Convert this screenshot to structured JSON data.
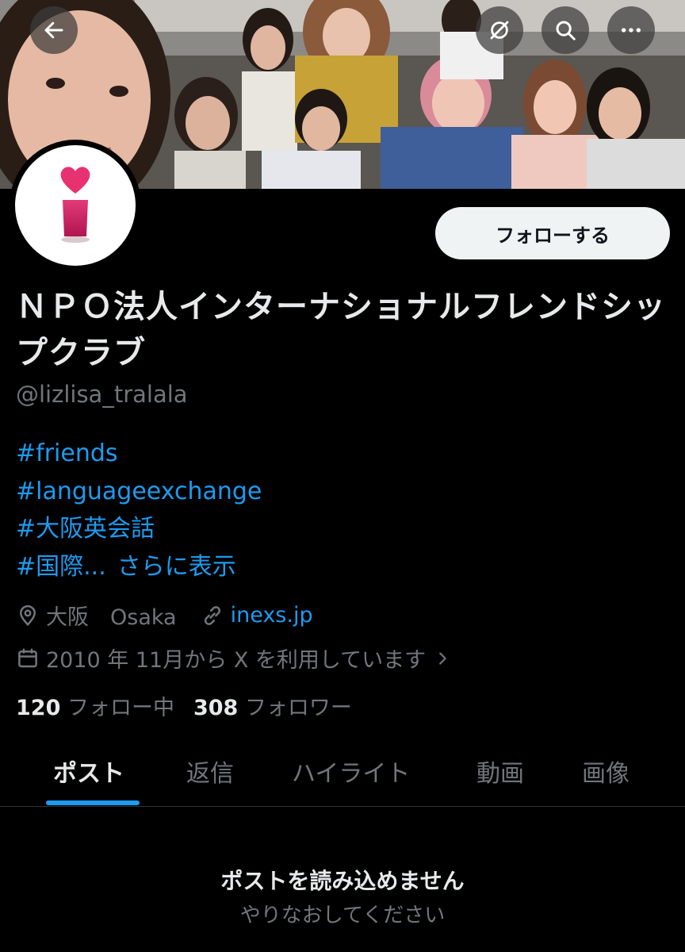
{
  "header": {
    "back_icon": "arrow-left-icon",
    "grok_icon": "slashed-circle-icon",
    "search_icon": "search-icon",
    "more_icon": "more-horizontal-icon"
  },
  "profile": {
    "display_name": "ＮＰＯ法人インターナショナルフレンドシップクラブ",
    "handle": "@lizlisa_tralala",
    "follow_label": "フォローする",
    "avatar_icon": "heart-i-logo-icon",
    "brand_color": "#c2185b"
  },
  "bio": {
    "tag1": "#friends",
    "tag2": "#languageexchange",
    "tag3": "#大阪英会話",
    "tag4": "#国際...",
    "show_more": "さらに表示"
  },
  "meta": {
    "location": "大阪　Osaka",
    "website": "inexs.jp",
    "joined": "2010 年 11月から X を利用しています"
  },
  "stats": {
    "following_count": "120",
    "following_label": "フォロー中",
    "followers_count": "308",
    "followers_label": "フォロワー"
  },
  "tabs": {
    "posts": "ポスト",
    "replies": "返信",
    "highlights": "ハイライト",
    "videos": "動画",
    "images": "画像"
  },
  "empty_state": {
    "title": "ポストを読み込めません",
    "subtitle": "やりなおしてください"
  },
  "colors": {
    "accent": "#1d9bf0",
    "background": "#000000",
    "text": "#e7e9ea",
    "muted": "#71767b"
  }
}
